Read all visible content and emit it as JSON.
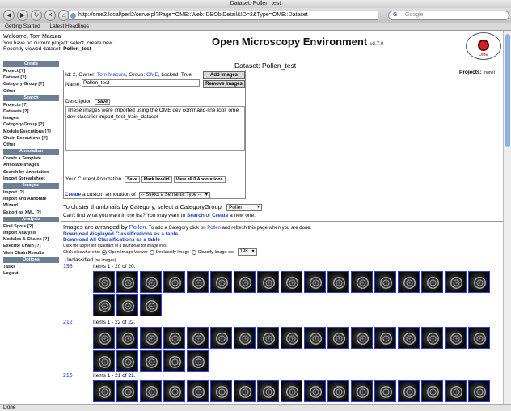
{
  "browser": {
    "window_title": "Dataset: Pollen_test",
    "url": "http://ome2.local/perl2/serve.pl?Page=OME::Web::DBObjDetail&ID=2&Type=OME::Dataset",
    "search_placeholder": "Google",
    "bookmarks": [
      "Getting Started",
      "Latest Headlines"
    ],
    "status": "Done"
  },
  "header": {
    "welcome": "Welcome, Tom Macura",
    "no_project": "You have no current project: select, create new",
    "recently_viewed_label": "Recently viewed dataset:",
    "recently_viewed": "Pollen_test",
    "app_title": "Open Microscopy Environment",
    "version": "v2.7.0",
    "logo_text": "OME"
  },
  "sidebar": {
    "sections": [
      {
        "title": "Create",
        "items": [
          "Project [?]",
          "Dataset [?]",
          "Category Group [?]",
          "Other"
        ]
      },
      {
        "title": "Search",
        "items": [
          "Projects [?]",
          "Datasets [?]",
          "Images",
          "Category Group [?]",
          "Module Executions [?]",
          "Chain Executions [?]",
          "Other"
        ]
      },
      {
        "title": "Annotation",
        "items": [
          "Create a Template",
          "Annotate Images",
          "Search by Annotation",
          "Import Spreadsheet"
        ]
      },
      {
        "title": "Images",
        "items": [
          "Import [?]",
          "Import and Annotate",
          "Wizard",
          "Export as XML [?]"
        ]
      },
      {
        "title": "Analysis",
        "items": [
          "Find Spots [?]",
          "Import Analysis",
          "Modules & Chains [?]",
          "Execute Chain [?]",
          "View Chain Results"
        ]
      },
      {
        "title": "Options",
        "items": [
          "Tasks",
          "Logout"
        ]
      }
    ]
  },
  "dataset": {
    "heading": "Dataset: Pollen_test",
    "projects_label": "Projects:",
    "projects_value": "(none)",
    "id_line_prefix": "Id: 2, Owner:",
    "owner": "Tom Macura",
    "group_prefix": ", Group:",
    "group": "OME",
    "locked_suffix": ", Locked: True",
    "name_label": "Name:",
    "name_value": "Pollen_test",
    "add_images": "Add Images",
    "remove_images": "Remove Images",
    "description_label": "Description",
    "save_label": "Save",
    "description_text": "These images were imported using the OME dev command-line tool: ome dev classifier import_test_train_dataset",
    "annotation_label": "Your Current Annotation",
    "mark_invalid": "Mark Invalid",
    "view_all": "View all 0 Annotations",
    "create_link": "Create",
    "create_suffix": "a custom annotation of",
    "semantic_type_select": "-- Select a Semantic Type --"
  },
  "cluster": {
    "text": "To cluster thumbnails by Category, select a CategoryGroup.",
    "select_value": "Pollen",
    "cantfind_prefix": "Can't find what you want in the list? You may want to",
    "search_link": "Search",
    "or": "or",
    "create_link": "Create",
    "cantfind_suffix": "a new one.",
    "arranged_prefix": "Images are arranged by",
    "arranged_link": "Pollen",
    "arranged_mid": ". To add a Category click on",
    "arranged_link2": "Pollen",
    "arranged_suffix": "and refresh this page when you are done.",
    "download_displayed": "Download displayed Classifications as a table",
    "download_all": "Download All Classifications as a table",
    "click_quadrant": "Click the upper left quadrant of a thumbnail for image info.",
    "click_elsewhere": "Click elsewhere to:",
    "opt_open": "Open Image Viewer",
    "opt_declassify": "Declassify Image",
    "opt_classify": "Classify Image as:",
    "classify_value": "198",
    "unclassified_label": "Unclassified",
    "unclassified_note": "(no images)"
  },
  "groups": [
    {
      "id": "198",
      "items_text": "Items 1 - 20 of 20.",
      "count": 20
    },
    {
      "id": "212",
      "items_text": "Items 1 - 22 of 22.",
      "count": 22
    },
    {
      "id": "216",
      "items_text": "Items 1 - 21 of 21.",
      "count": 21
    }
  ]
}
